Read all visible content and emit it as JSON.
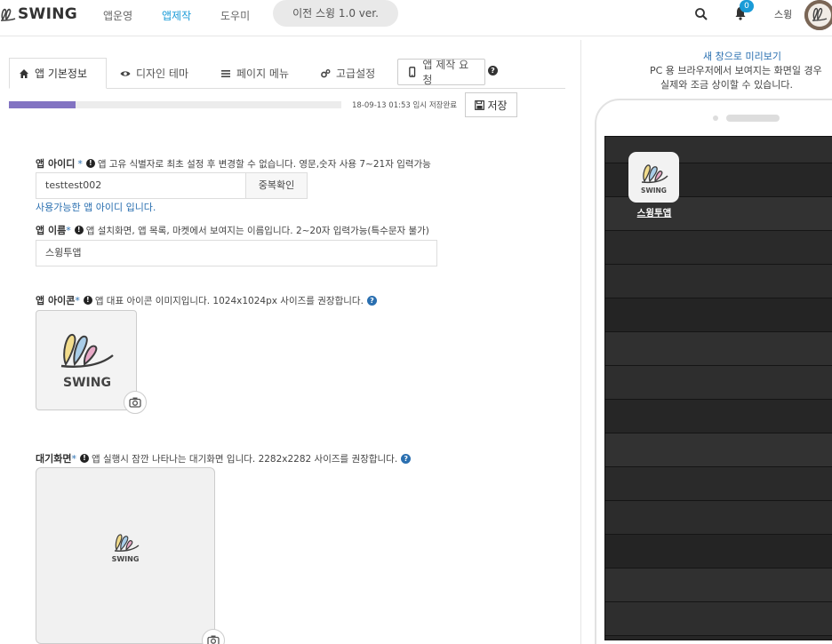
{
  "brand": {
    "name": "SWING",
    "accent": "#1a9bd7",
    "link_color": "#2a6fb0",
    "progress_color": "#8273c2"
  },
  "nav": {
    "items": [
      {
        "label": "앱운영",
        "active": false
      },
      {
        "label": "앱제작",
        "active": true
      },
      {
        "label": "도우미",
        "active": false
      }
    ],
    "prev_version": "이전 스윙 1.0 ver.",
    "notifications": "0",
    "user": "스윙",
    "icons": {
      "search": "search-icon",
      "bell": "bell-icon",
      "avatar": "avatar-image"
    }
  },
  "tabs": [
    {
      "label": "앱 기본정보",
      "icon": "home-icon",
      "active": true
    },
    {
      "label": "디자인 테마",
      "icon": "eye-icon",
      "active": false
    },
    {
      "label": "페이지 메뉴",
      "icon": "menu-icon",
      "active": false
    },
    {
      "label": "고급설정",
      "icon": "gears-icon",
      "active": false
    },
    {
      "label": "앱 제작 요청",
      "icon": "mobile-icon",
      "active": false
    }
  ],
  "progress": {
    "percent": 20,
    "saved_text": "18-09-13 01:53 임시 저장완료",
    "save_label": "저장"
  },
  "form": {
    "app_id": {
      "label": "앱 아이디",
      "required": "*",
      "desc": "앱 고유 식별자로 최초 설정 후 변경할 수 없습니다. 영문,숫자 사용 7~21자 입력가능",
      "value": "testtest002",
      "check_button": "중복확인",
      "available_msg": "사용가능한 앱 아이디 입니다."
    },
    "app_name": {
      "label": "앱 이름",
      "required": "*",
      "desc": "앱 설치화면, 앱 목록, 마켓에서 보여지는 이름입니다. 2~20자 입력가능(특수문자 불가)",
      "value": "스윙투앱"
    },
    "app_icon": {
      "label": "앱 아이콘",
      "required": "*",
      "desc": "앱 대표 아이콘 이미지입니다. 1024x1024px 사이즈를 권장합니다."
    },
    "splash": {
      "label": "대기화면",
      "required": "*",
      "desc": "앱 실행시 잠깐 나타나는 대기화면 입니다. 2282x2282 사이즈를 권장합니다."
    },
    "logo_text": "SWING"
  },
  "preview": {
    "link": "새 창으로 미리보기",
    "note_line1": "PC 용 브라우저에서 보여지는 화면일 경우",
    "note_line2": "실제와 조금 상이할 수 있습니다.",
    "app_label": "스윙투앱"
  }
}
